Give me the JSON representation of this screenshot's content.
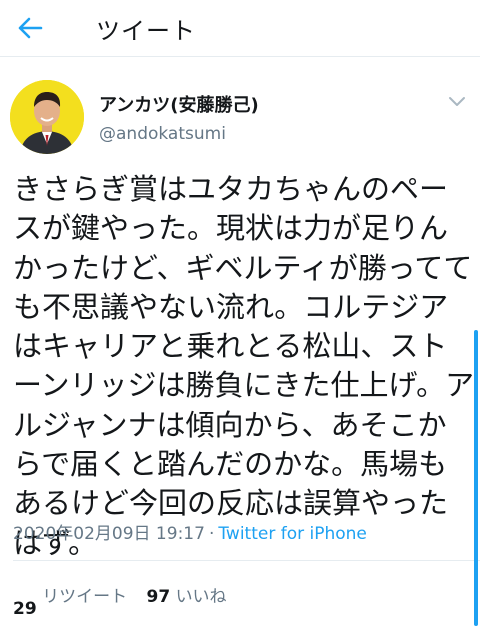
{
  "header": {
    "title": "ツイート",
    "back_icon": "arrow-left-icon",
    "accent_color": "#1da1f2"
  },
  "author": {
    "display_name": "アンカツ(安藤勝己)",
    "handle": "@andokatsumi",
    "avatar_bg": "#f3df1e"
  },
  "tweet": {
    "text": "きさらぎ賞はユタカちゃんのペースが鍵やった。現状は力が足りんかったけど、ギベルティが勝ってても不思議やない流れ。コルテジアはキャリアと乗れとる松山、ストーンリッジは勝負にきた仕上げ。アルジャンナは傾向から、あそこからで届くと踏んだのかな。馬場もあるけど今回の反応は誤算やったはず。",
    "timestamp": "2020年02月09日 19:17",
    "separator": "·",
    "client": "Twitter for iPhone"
  },
  "stats": {
    "retweets_count": "29",
    "retweets_label": "リツイート",
    "likes_count": "97",
    "likes_label": "いいね"
  }
}
